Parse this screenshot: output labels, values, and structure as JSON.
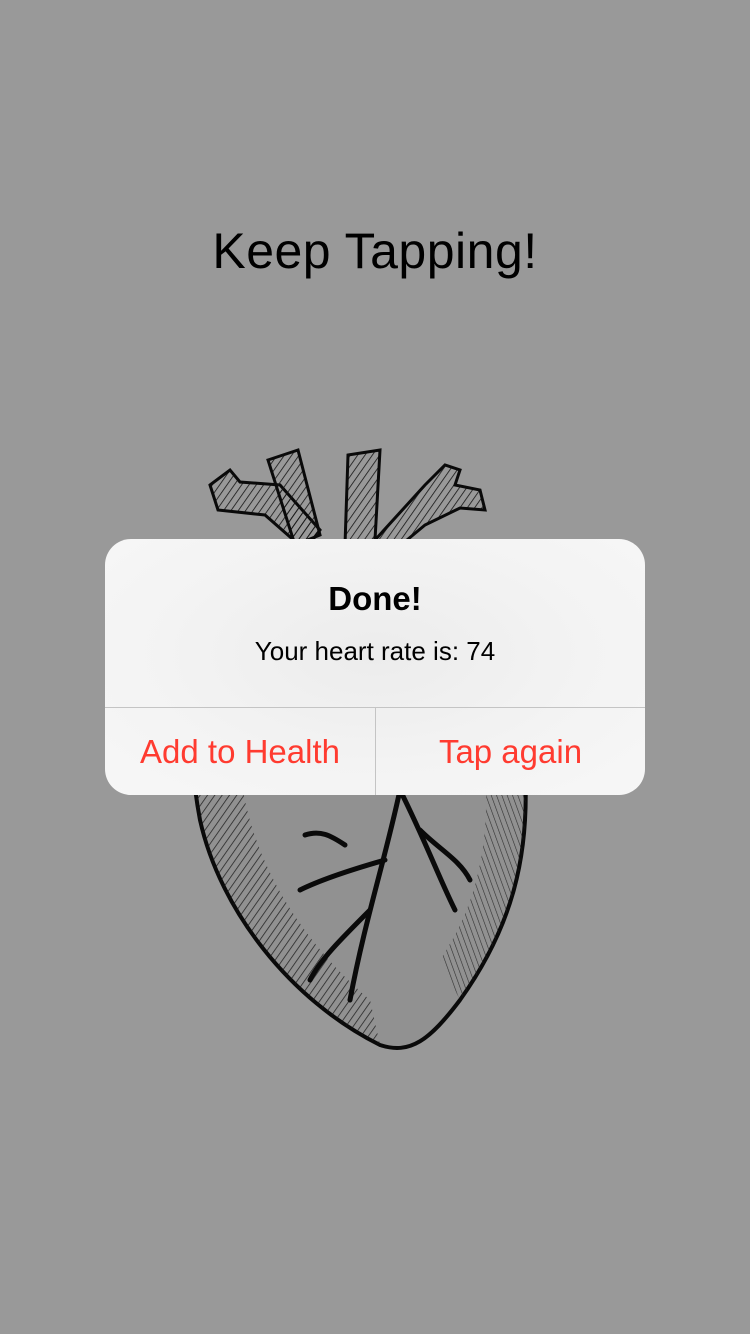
{
  "screen": {
    "title": "Keep Tapping!",
    "heart_image": "anatomical-heart-illustration"
  },
  "alert": {
    "title": "Done!",
    "message": "Your heart rate is: 74",
    "buttons": [
      {
        "label": "Add to Health"
      },
      {
        "label": "Tap again"
      }
    ],
    "accent_color": "#ff3b30"
  }
}
